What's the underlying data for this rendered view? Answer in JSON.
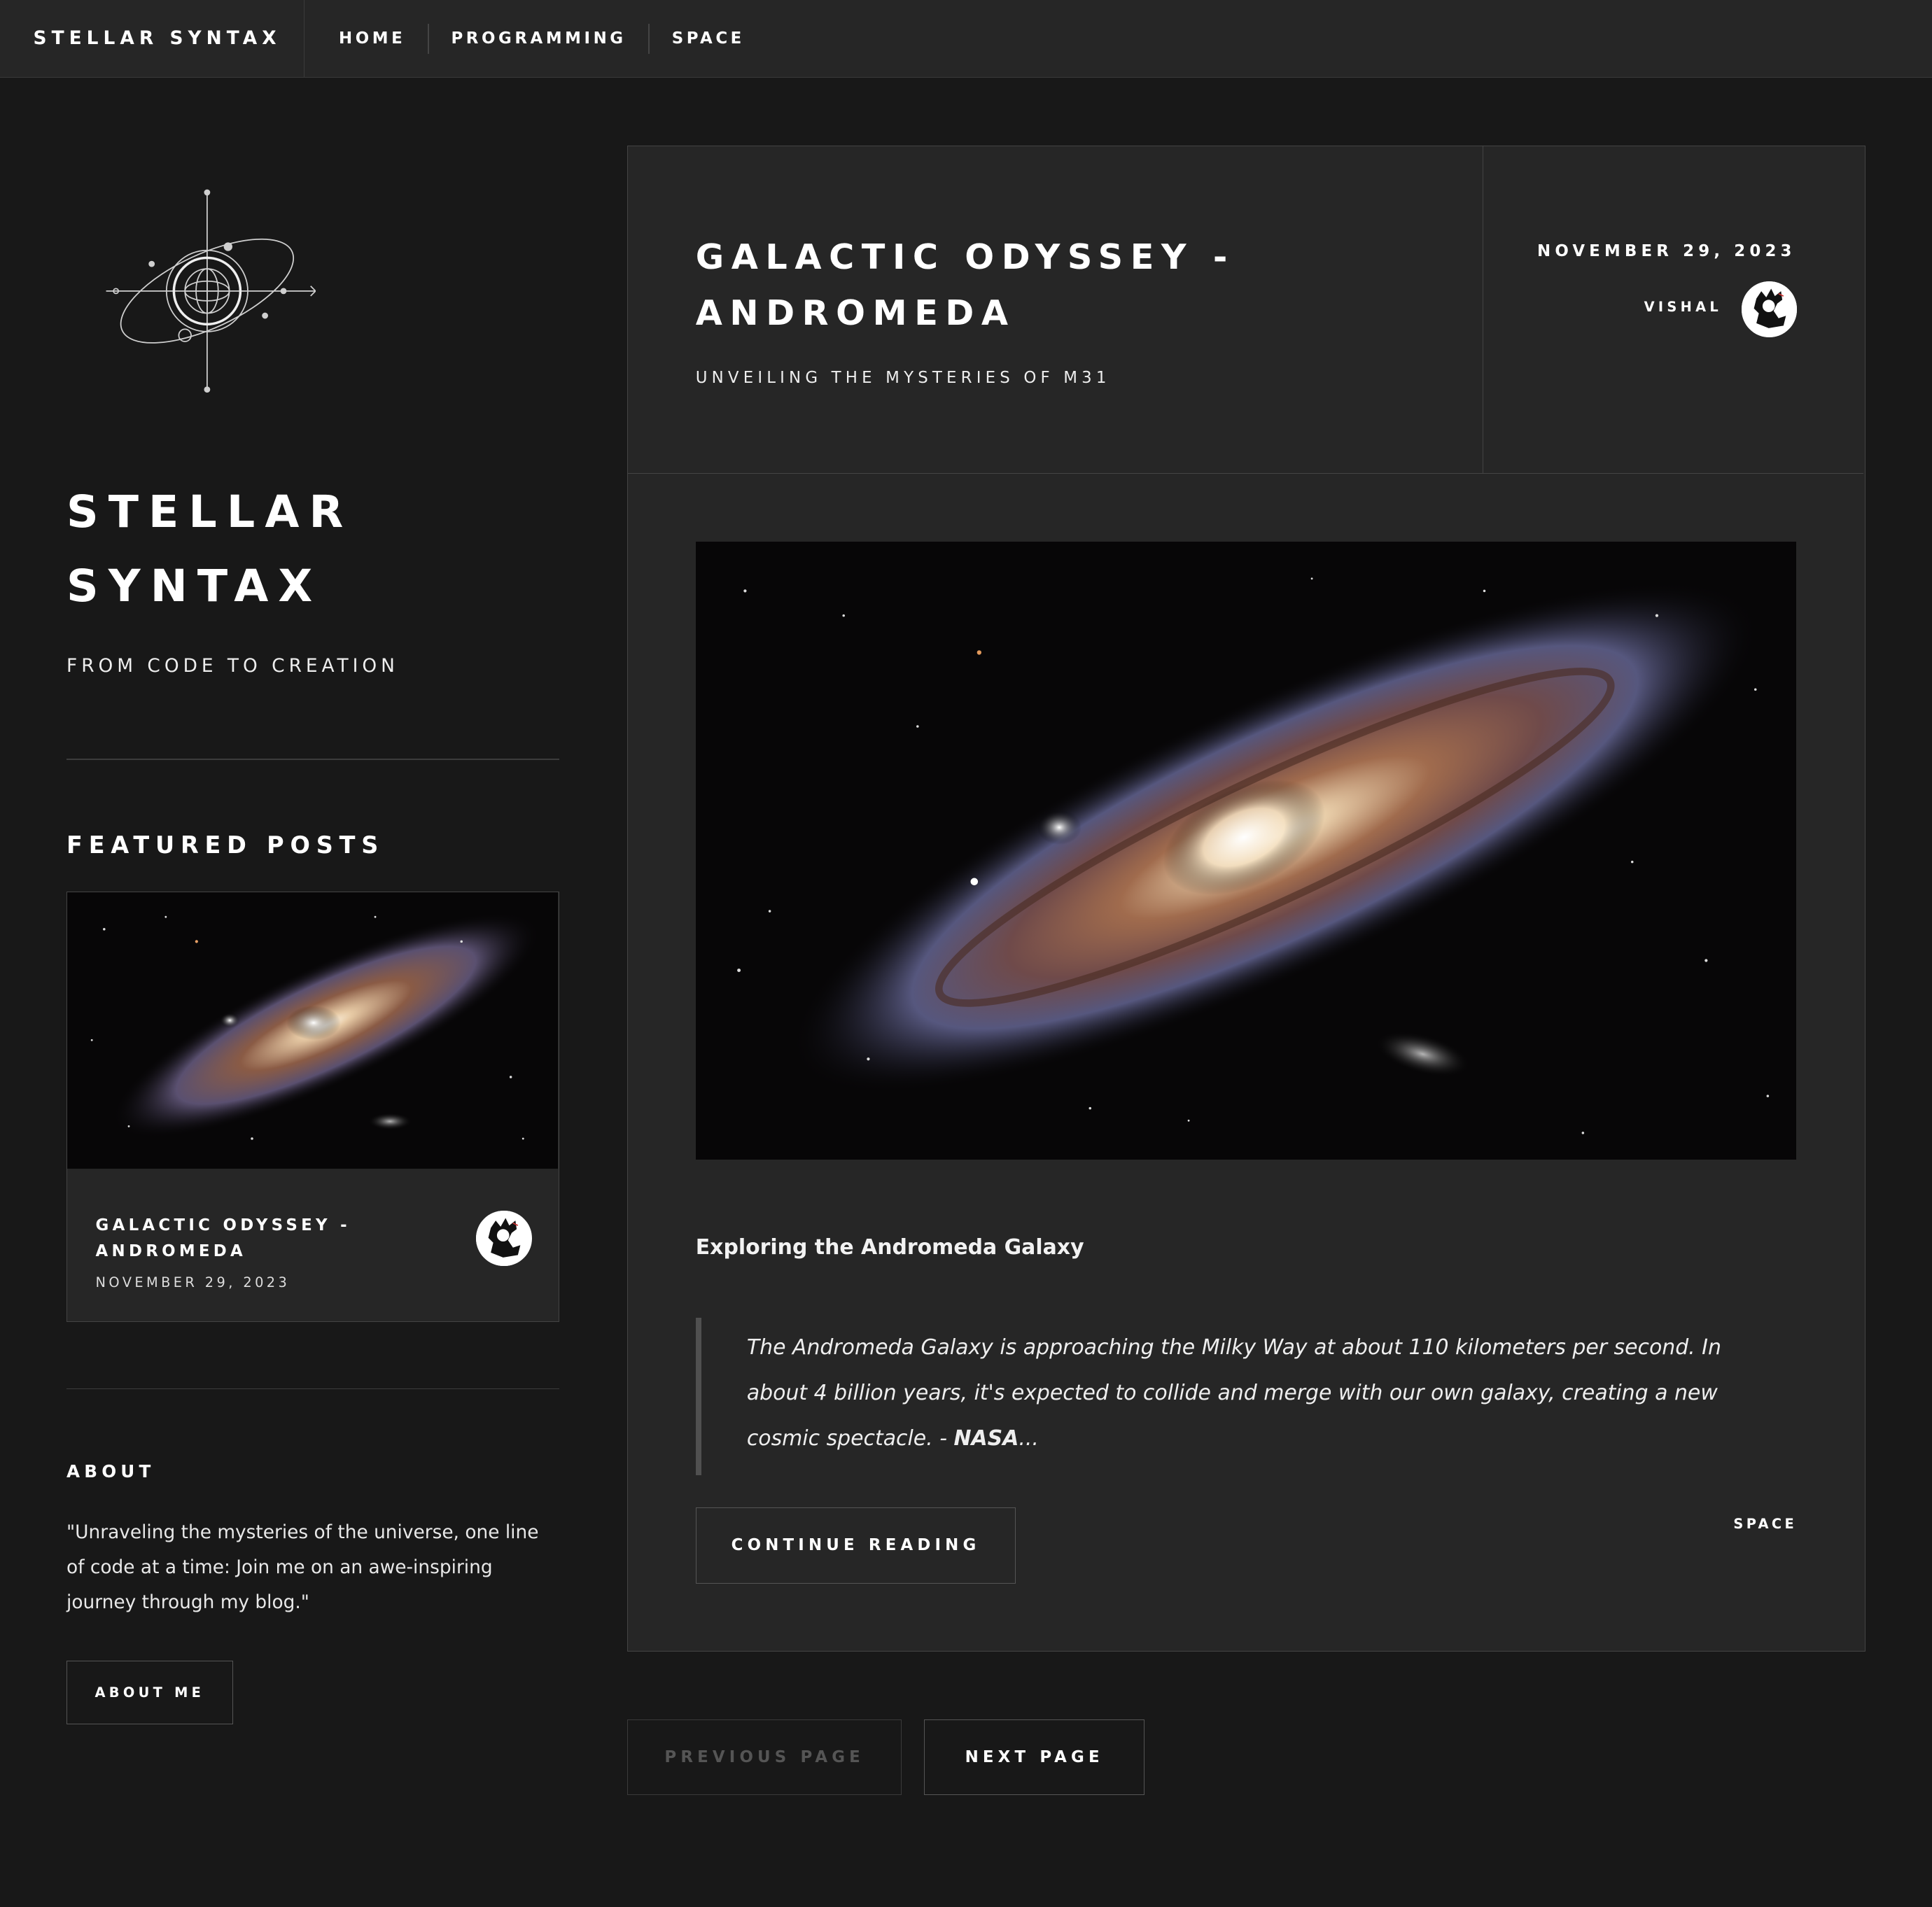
{
  "header": {
    "brand": "STELLAR SYNTAX",
    "nav": [
      "HOME",
      "PROGRAMMING",
      "SPACE"
    ]
  },
  "sidebar": {
    "title_line1": "STELLAR",
    "title_line2": "SYNTAX",
    "tagline": "FROM CODE TO CREATION",
    "featured_heading": "FEATURED POSTS",
    "featured_post": {
      "title_line1": "GALACTIC ODYSSEY -",
      "title_line2": "ANDROMEDA",
      "date": "NOVEMBER 29, 2023"
    },
    "about_heading": "ABOUT",
    "about_text": "\"Unraveling the mysteries of the universe, one line of code at a time: Join me on an awe-inspiring journey through my blog.\"",
    "about_button": "ABOUT ME"
  },
  "post": {
    "title_line1": "GALACTIC ODYSSEY -",
    "title_line2": "ANDROMEDA",
    "subtitle": "UNVEILING THE MYSTERIES OF M31",
    "date": "NOVEMBER 29, 2023",
    "author": "VISHAL",
    "excerpt_title": "Exploring the Andromeda Galaxy",
    "quote": "The Andromeda Galaxy is approaching the Milky Way at about 110 kilometers per second. In about 4 billion years, it's expected to collide and merge with our own galaxy, creating a new cosmic spectacle. -",
    "quote_source": "NASA",
    "quote_ellipsis": "...",
    "continue_button": "CONTINUE READING",
    "tag": "SPACE"
  },
  "pagination": {
    "previous": "PREVIOUS PAGE",
    "next": "NEXT PAGE"
  }
}
